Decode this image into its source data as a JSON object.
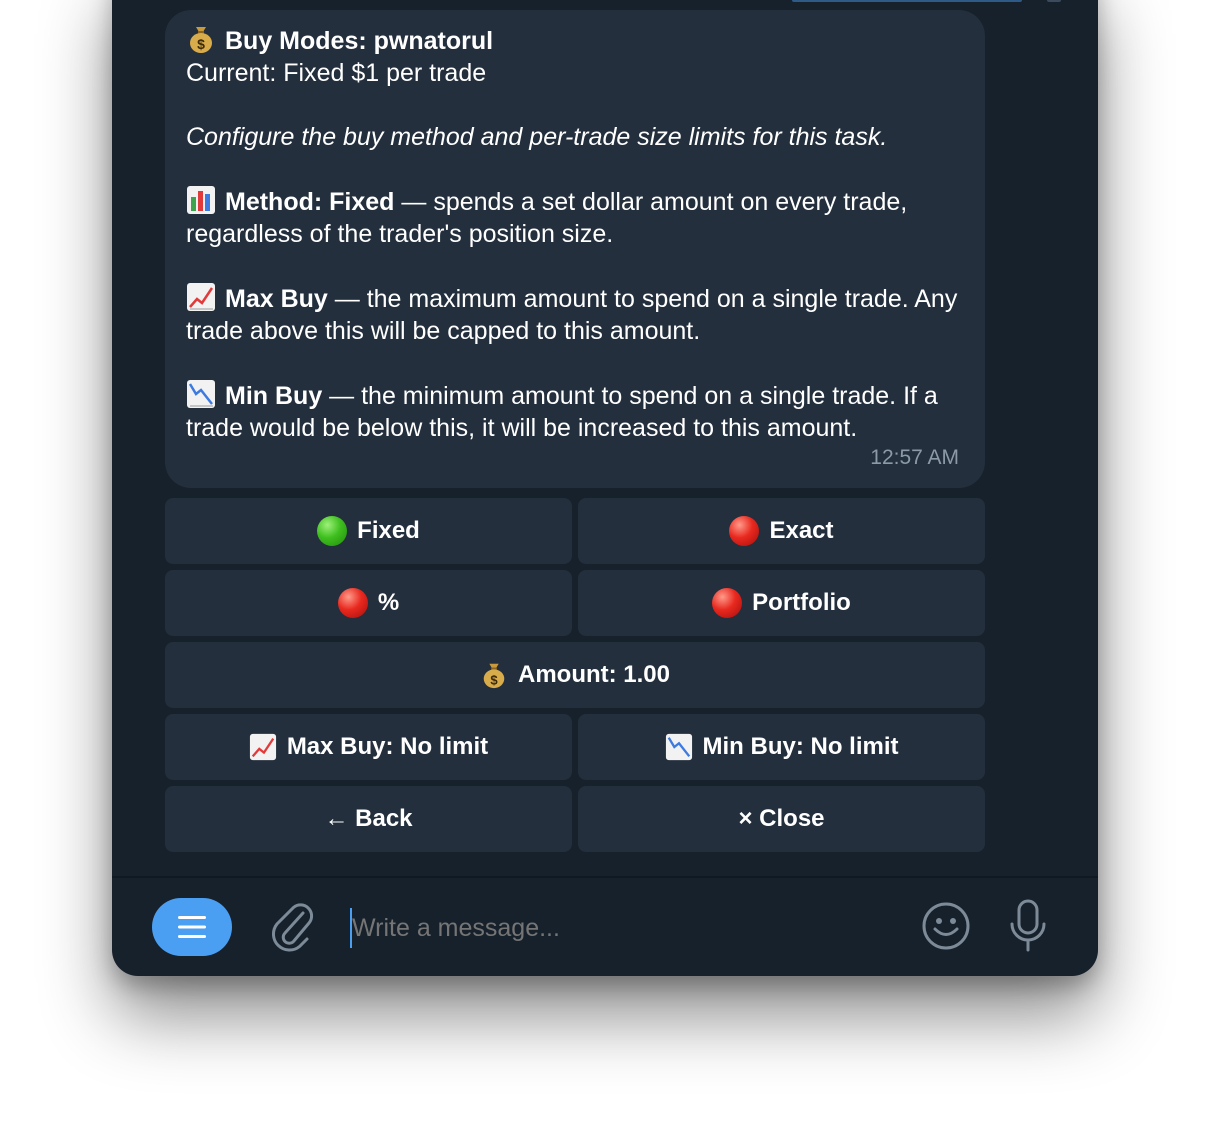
{
  "message": {
    "title_emoji": "money-bag",
    "title": "Buy Modes: pwnatorul",
    "current": "Current: Fixed $1 per trade",
    "description": "Configure the buy method and per-trade size limits for this task.",
    "method_label": "Method: Fixed",
    "method_text": " — spends a set dollar amount on every trade, regardless of the trader's position size.",
    "max_label": "Max Buy",
    "max_text": " — the maximum amount to spend on a single trade. Any trade above this will be capped to this amount.",
    "min_label": "Min Buy",
    "min_text": " — the minimum amount to spend on a single trade. If a trade would be below this, it will be increased to this amount.",
    "time": "12:57 AM"
  },
  "buttons": {
    "fixed": "Fixed",
    "exact": "Exact",
    "percent": "%",
    "portfolio": "Portfolio",
    "amount": "Amount: 1.00",
    "max_buy": "Max Buy: No limit",
    "min_buy": "Min Buy: No limit",
    "back": "← Back",
    "close": "× Close"
  },
  "composer": {
    "placeholder": "Write a message..."
  },
  "colors": {
    "window_bg": "#17212b",
    "bubble_bg": "#232f3d",
    "accent": "#4b9ff2",
    "active_dot": "#3fbf1f",
    "inactive_dot": "#e8291f"
  }
}
